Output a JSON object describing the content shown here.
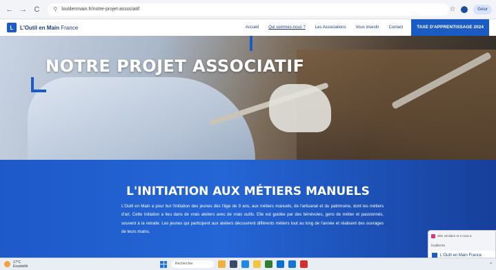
{
  "browser": {
    "back": "←",
    "forward": "→",
    "reload": "C",
    "url": "loutilenmain.fr/notre-projet-associatif",
    "profile_pill": "Gelur"
  },
  "header": {
    "logo_glyph": "L",
    "brand_bold": "L'Outil en Main",
    "brand_rest": " France",
    "menu": [
      {
        "label": "Accueil"
      },
      {
        "label": "Qui sommes-nous ?"
      },
      {
        "label": "Les Associations"
      },
      {
        "label": "Vous investir"
      },
      {
        "label": "Contact"
      }
    ],
    "cta": "TAXE D'APPRENTISSAGE 2024"
  },
  "hero": {
    "title": "NOTRE PROJET ASSOCIATIF"
  },
  "section": {
    "title": "L'INITIATION AUX MÉTIERS MANUELS",
    "body": "L'Outil en Main a pour but l'initiation des jeunes dès l'âge de 9 ans, aux métiers manuels, de l'artisanat et du patrimoine, dont les métiers d'art. Cette initiation a lieu dans de vrais ateliers avec de vrais outils. Elle est guidée par des bénévoles, gens de métier et passionnés, souvent à la retraite. Les jeunes qui participent aux ateliers découvrent différents métiers tout au long de l'année et réalisent des ouvrages de leurs mains."
  },
  "mini_window": {
    "tab": "aller similaire et 2 mois a",
    "url": "loutilenm",
    "brand": "L'Outil en Main France"
  },
  "taskbar": {
    "temp": "17°C",
    "weather": "Ensoleillé",
    "search": "Rechercher"
  },
  "colors": {
    "brand_blue": "#1a5bc4",
    "band_blue": "#2466d6"
  }
}
